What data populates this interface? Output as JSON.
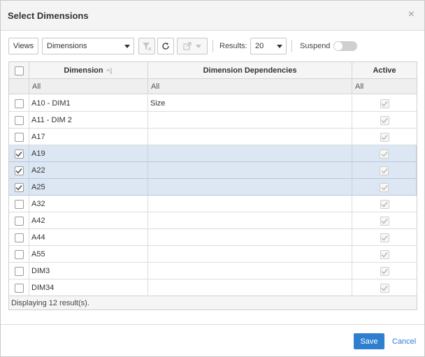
{
  "dialog": {
    "title": "Select Dimensions",
    "close_symbol": "×"
  },
  "toolbar": {
    "views_label": "Views",
    "view_select_value": "Dimensions",
    "results_label": "Results:",
    "results_value": "20",
    "suspend_label": "Suspend",
    "suspend_on": false
  },
  "grid": {
    "columns": [
      "Dimension",
      "Dimension Dependencies",
      "Active"
    ],
    "filters": [
      "All",
      "All",
      "All"
    ],
    "rows": [
      {
        "dimension": "A10 - DIM1",
        "dependencies": "Size",
        "selected": false,
        "active": true
      },
      {
        "dimension": "A11 - DIM 2",
        "dependencies": "",
        "selected": false,
        "active": true
      },
      {
        "dimension": "A17",
        "dependencies": "",
        "selected": false,
        "active": true
      },
      {
        "dimension": "A19",
        "dependencies": "",
        "selected": true,
        "active": true
      },
      {
        "dimension": "A22",
        "dependencies": "",
        "selected": true,
        "active": true
      },
      {
        "dimension": "A25",
        "dependencies": "",
        "selected": true,
        "active": true
      },
      {
        "dimension": "A32",
        "dependencies": "",
        "selected": false,
        "active": true
      },
      {
        "dimension": "A42",
        "dependencies": "",
        "selected": false,
        "active": true
      },
      {
        "dimension": "A44",
        "dependencies": "",
        "selected": false,
        "active": true
      },
      {
        "dimension": "A55",
        "dependencies": "",
        "selected": false,
        "active": true
      },
      {
        "dimension": "DIM3",
        "dependencies": "",
        "selected": false,
        "active": true
      },
      {
        "dimension": "DIM34",
        "dependencies": "",
        "selected": false,
        "active": true
      }
    ],
    "status_text": "Displaying 12 result(s)."
  },
  "actions": {
    "save_label": "Save",
    "cancel_label": "Cancel"
  },
  "colors": {
    "accent": "#2f7fd0",
    "selected_row": "#dde6f3"
  }
}
